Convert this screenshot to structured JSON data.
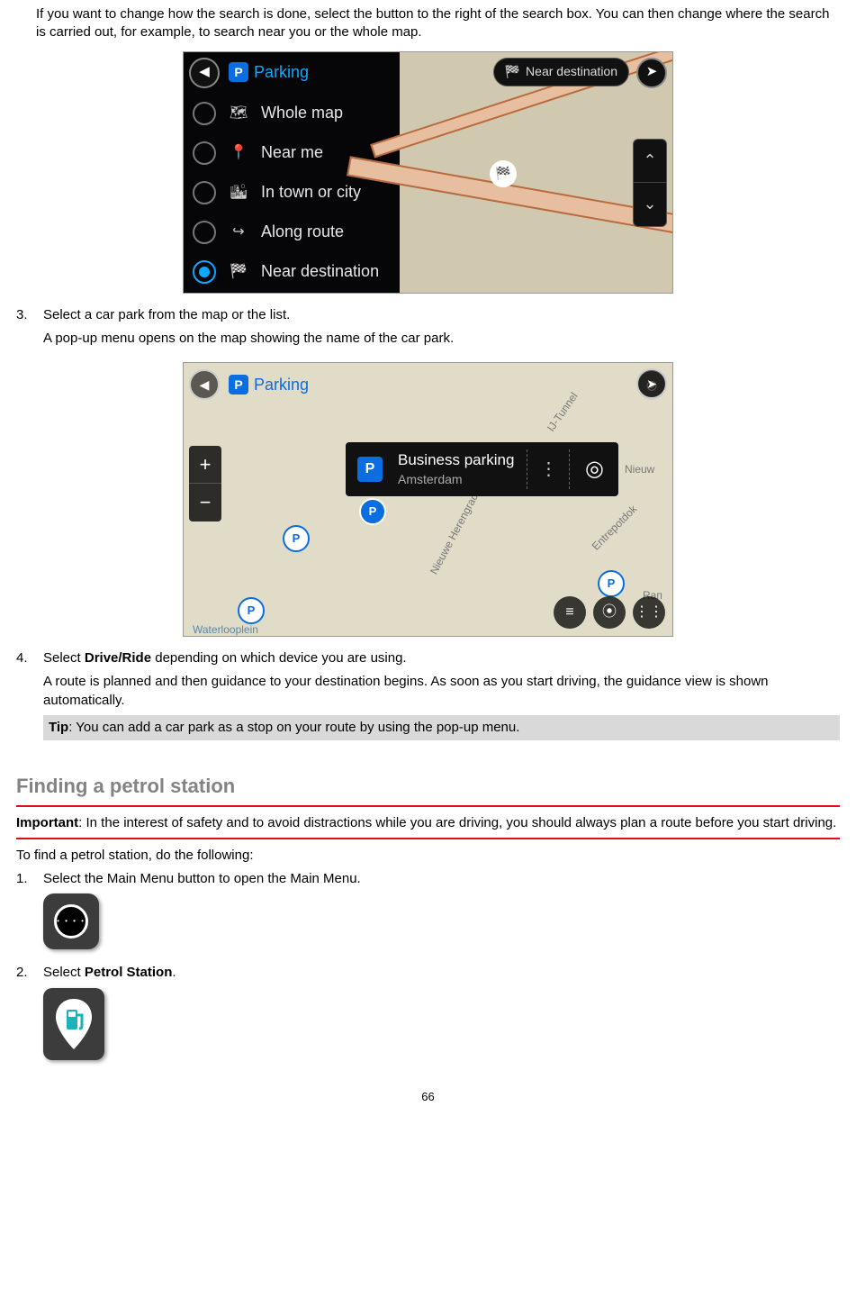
{
  "intro_para": "If you want to change how the search is done, select the button to the right of the search box. You can then change where the search is carried out, for example, to search near you or the whole map.",
  "fig1": {
    "search_label": "Parking",
    "pill_label": "Near destination",
    "menu": [
      {
        "icon": "🗺",
        "label": "Whole map"
      },
      {
        "icon": "📍",
        "label": "Near me"
      },
      {
        "icon": "🏙",
        "label": "In town or city"
      },
      {
        "icon": "↪",
        "label": "Along route"
      },
      {
        "icon": "🏁",
        "label": "Near destination"
      }
    ]
  },
  "step3": {
    "num": "3.",
    "line1": "Select a car park from the map or the list.",
    "line2": "A pop-up menu opens on the map showing the name of the car park."
  },
  "fig2": {
    "label": "Parking",
    "popup_title": "Business parking",
    "popup_sub": "Amsterdam",
    "street1": "Nieuwe Herengracht",
    "street2": "IJ-Tunnel",
    "street3": "Nieuw",
    "street4": "Entrepotdok",
    "street5": "Rап",
    "street6": "Waterlooplein"
  },
  "step4": {
    "num": "4.",
    "line1a": "Select ",
    "line1b": "Drive/Ride",
    "line1c": " depending on which device you are using.",
    "line2": "A route is planned and then guidance to your destination begins. As soon as you start driving, the guidance view is shown automatically."
  },
  "tip": {
    "label": "Tip",
    "text": ": You can add a car park as a stop on your route by using the pop-up menu."
  },
  "section_title": "Finding a petrol station",
  "important": {
    "label": "Important",
    "text": ": In the interest of safety and to avoid distractions while you are driving, you should always plan a route before you start driving."
  },
  "petrol_intro": "To find a petrol station, do the following:",
  "pstep1": {
    "num": "1.",
    "text": "Select the Main Menu button to open the Main Menu."
  },
  "pstep2": {
    "num": "2.",
    "text_a": "Select ",
    "text_b": "Petrol Station",
    "text_c": "."
  },
  "page_number": "66"
}
